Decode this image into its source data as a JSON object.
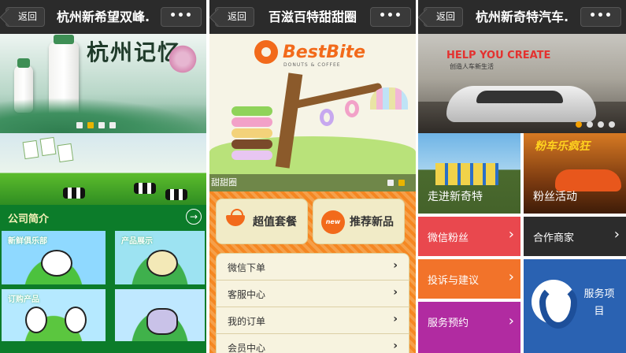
{
  "panels": [
    {
      "back_label": "返回",
      "title": "杭州新希望双峰.",
      "more_label": "•••",
      "banner": {
        "calligraphy": "杭州记忆",
        "dots": 4,
        "active_dot": 1
      },
      "section_title": "公司简介",
      "section_arrow": "→",
      "tiles": [
        {
          "label": "新鲜俱乐部"
        },
        {
          "label": "产品展示"
        },
        {
          "label": "订购产品"
        },
        {
          "label": ""
        }
      ]
    },
    {
      "back_label": "返回",
      "title": "百滋百特甜甜圈",
      "more_label": "•••",
      "banner": {
        "brand": "BestBite",
        "brand_sub": "DONUTS & COFFEE",
        "caption": "甜甜圈",
        "dots": 2,
        "active_dot": 1
      },
      "big_buttons": [
        {
          "label": "超值套餐",
          "icon": "bowl-icon"
        },
        {
          "label": "推荐新品",
          "icon": "new-badge-icon",
          "badge": "new"
        }
      ],
      "menu": [
        {
          "label": "微信下单"
        },
        {
          "label": "客服中心"
        },
        {
          "label": "我的订单"
        },
        {
          "label": "会员中心"
        }
      ],
      "chevron": "›"
    },
    {
      "back_label": "返回",
      "title": "杭州新奇特汽车.",
      "more_label": "•••",
      "banner": {
        "headline": "HELP YOU CREATE",
        "subline": "创造人车新生活",
        "dots": 4,
        "active_dot": 0
      },
      "cells": [
        {
          "label": "走进新奇特"
        },
        {
          "label": "粉丝活动",
          "logo": "粉车乐疯狂"
        },
        {
          "label": "微信粉丝"
        },
        {
          "label": "合作商家"
        },
        {
          "label": "投诉与建议"
        },
        {
          "label": "服务项目"
        },
        {
          "label": "服务预约"
        }
      ],
      "chevron": "›",
      "colors": {
        "red": "#e9484e",
        "dark": "#2c2c2c",
        "orange": "#f2732a",
        "blue": "#2a62b2",
        "purple": "#b12ba1"
      }
    }
  ]
}
